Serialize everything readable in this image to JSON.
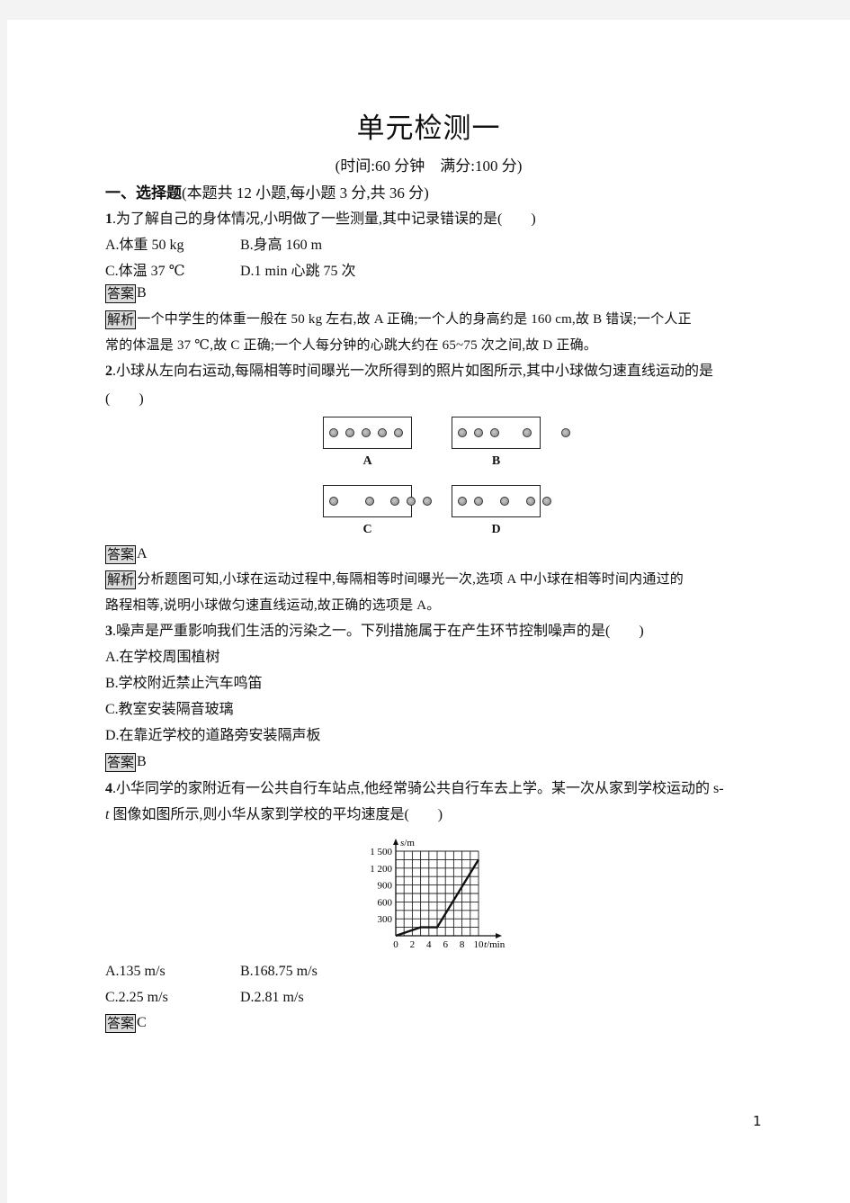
{
  "title": "单元检测一",
  "subtitle": "(时间:60 分钟　满分:100 分)",
  "section1": {
    "heading": "一、选择题",
    "note": "(本题共 12 小题,每小题 3 分,共 36 分)"
  },
  "answer_tag": "答案",
  "explain_tag": "解析",
  "q1": {
    "num": "1",
    "text": ".为了解自己的身体情况,小明做了一些测量,其中记录错误的是(　　)",
    "options": [
      "A.体重 50 kg",
      "B.身高 160 m",
      "C.体温 37 ℃",
      "D.1 min 心跳 75 次"
    ],
    "answer": "B",
    "explanation_l1": "一个中学生的体重一般在 50 kg 左右,故 A 正确;一个人的身高约是 160 cm,故 B 错误;一个人正",
    "explanation_l2": "常的体温是 37 ℃,故 C 正确;一个人每分钟的心跳大约在 65~75 次之间,故 D 正确。"
  },
  "q2": {
    "num": "2",
    "text_l1": ".小球从左向右运动,每隔相等时间曝光一次所得到的照片如图所示,其中小球做匀速直线运动的是",
    "text_l2": "(　　)",
    "figure": {
      "panels": [
        {
          "label": "A",
          "ball_positions": [
            1,
            2,
            3,
            4,
            5
          ]
        },
        {
          "label": "B",
          "ball_positions": [
            1,
            2,
            3,
            5,
            7.4
          ]
        },
        {
          "label": "C",
          "ball_positions": [
            1,
            3.2,
            4.8,
            5.8,
            6.8
          ]
        },
        {
          "label": "D",
          "ball_positions": [
            1,
            2,
            3.6,
            5.2,
            6.2
          ]
        }
      ]
    },
    "answer": "A",
    "explanation_l1": "分析题图可知,小球在运动过程中,每隔相等时间曝光一次,选项 A 中小球在相等时间内通过的",
    "explanation_l2": "路程相等,说明小球做匀速直线运动,故正确的选项是 A。"
  },
  "q3": {
    "num": "3",
    "text": ".噪声是严重影响我们生活的污染之一。下列措施属于在产生环节控制噪声的是(　　)",
    "options": [
      "A.在学校周围植树",
      "B.学校附近禁止汽车鸣笛",
      "C.教室安装隔音玻璃",
      "D.在靠近学校的道路旁安装隔声板"
    ],
    "answer": "B"
  },
  "q4": {
    "num": "4",
    "text_l1": ".小华同学的家附近有一公共自行车站点,他经常骑公共自行车去上学。某一次从家到学校运动的 s-",
    "text_l2_var": "t",
    "text_l2": " 图像如图所示,则小华从家到学校的平均速度是(　　)",
    "options": [
      "A.135 m/s",
      "B.168.75 m/s",
      "C.2.25 m/s",
      "D.2.81 m/s"
    ],
    "answer": "C"
  },
  "chart_data": {
    "type": "line",
    "title": "",
    "xlabel": "t/min",
    "ylabel": "s/m",
    "xlim": [
      0,
      10
    ],
    "ylim": [
      0,
      1500
    ],
    "x_ticks": [
      0,
      2,
      4,
      6,
      8,
      10
    ],
    "x_tick_labels": [
      "0",
      "2",
      "4",
      "6",
      "8",
      "10"
    ],
    "y_ticks": [
      300,
      600,
      900,
      1200,
      1500
    ],
    "y_tick_labels": [
      "300",
      "600",
      "900",
      "1 200",
      "1 500"
    ],
    "grid": true,
    "grid_step_x": 1,
    "grid_step_y": 150,
    "series": [
      {
        "name": "s-t",
        "x": [
          0,
          3,
          5,
          10
        ],
        "y": [
          0,
          150,
          150,
          1350
        ]
      }
    ]
  },
  "page_number": "1"
}
